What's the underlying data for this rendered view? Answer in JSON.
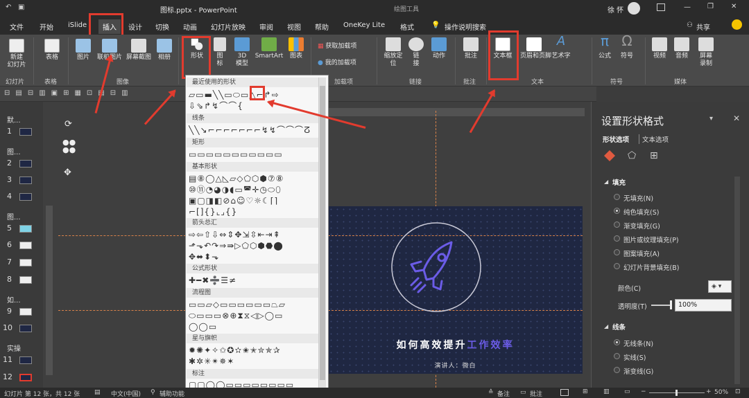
{
  "window": {
    "title": "图标.pptx - PowerPoint",
    "context_tool": "绘图工具",
    "user": "徐 怀",
    "minimize": "—",
    "maximize": "❐",
    "close": "✕",
    "restore": "⊟"
  },
  "tabs": [
    "文件",
    "开始",
    "iSlide",
    "插入",
    "设计",
    "切换",
    "动画",
    "幻灯片放映",
    "审阅",
    "视图",
    "帮助",
    "OneKey Lite",
    "格式"
  ],
  "tell_me": "操作说明搜索",
  "share": "共享",
  "ribbon": {
    "new_slide": "新建\n幻灯片",
    "table": "表格",
    "picture": "图片",
    "online_picture": "联机图片",
    "screenshot": "屏幕截图",
    "album": "相册",
    "shapes": "形状",
    "icons": "图\n标",
    "model3d": "3D\n模型",
    "smartart": "SmartArt",
    "chart": "图表",
    "get_addins": "获取加载项",
    "my_addins": "我的加载项",
    "zoom": "缩放定\n位",
    "link": "链\n接",
    "action": "动作",
    "comment": "批注",
    "textbox": "文本框",
    "header_footer": "页眉和页脚",
    "wordart": "艺术字",
    "equation": "公式",
    "symbol": "符号",
    "video": "视频",
    "audio": "音频",
    "screen_record": "屏幕\n录制",
    "groups": [
      "幻灯片",
      "表格",
      "图像",
      "加载项",
      "链接",
      "批注",
      "文本",
      "符号",
      "媒体"
    ]
  },
  "slide_panel": {
    "sections": [
      "默...",
      "图...",
      "图...",
      "如...",
      "实操"
    ],
    "numbers": [
      "1",
      "2",
      "3",
      "4",
      "5",
      "6",
      "7",
      "8",
      "9",
      "10",
      "11",
      "12"
    ]
  },
  "dropdown": {
    "headers": [
      "最近使用的形状",
      "线条",
      "矩形",
      "基本形状",
      "箭头总汇",
      "公式形状",
      "流程图",
      "星与旗帜",
      "标注"
    ],
    "rows": {
      "recent": [
        "▱▭▬╲╲▭⬭▭△⌐↱⇨",
        "⇩⇘↱↯⌒⌒{"
      ],
      "lines": [
        "╲╲↘⌐⌐⌐⌐⌐⌐⌐↯↯⌒⌒⌒ⵒ"
      ],
      "rect": [
        "▭▭▭▭▭▭▭▭▭▭▭"
      ],
      "basic": [
        "▤⑧◯△◺▱◇⬠⬡⬢⑦⑧",
        "⑩⑪◔◕◑◖▭◚✛◷⬭⬯",
        "▣▢◨◧⊘⌂☺♡☼☾⌈⌉",
        "⌐[]{}⌞⌟{}"
      ],
      "arrows": [
        "⇨⇦⇧⇩⇔⇕✥⇲⇳⇤⇥⇞",
        "⬏⬎↶↷⇒⇛▷⬠⬡⬢⬣⬤",
        "✥⬌⬍⬎"
      ],
      "equation": [
        "✚━✖➗☰≠"
      ],
      "flow": [
        "▭▭▱◇▭▭▭▭▭▭⏢▱",
        "⬭▭▭▭⊗⊕⧗⧖◁▷◯▭",
        "◯◯▭"
      ],
      "stars": [
        "✹✺✦✧✩✪✫✬✭✮✯✰",
        "✱✲✳✴✵✶"
      ],
      "callout": [
        "▢▢◯◯▭▭▭▭▭▭▭▭"
      ]
    }
  },
  "slide": {
    "title_a": "如何高效提升",
    "title_b": "工作效率",
    "subtitle": "演讲人：微白"
  },
  "format_pane": {
    "title": "设置形状格式",
    "tab_shape": "形状选项",
    "tab_text": "文本选项",
    "fill_section": "填充",
    "fill_options": [
      "无填充(N)",
      "纯色填充(S)",
      "渐变填充(G)",
      "图片或纹理填充(P)",
      "图案填充(A)",
      "幻灯片背景填充(B)"
    ],
    "color_label": "颜色(C)",
    "transparency_label": "透明度(T)",
    "transparency_value": "100%",
    "line_section": "线条",
    "line_options": [
      "无线条(N)",
      "实线(S)",
      "渐变线(G)"
    ]
  },
  "statusbar": {
    "slide_info": "幻灯片 第 12 张，共 12 张",
    "language": "中文(中国)",
    "accessibility": "辅助功能",
    "notes": "备注",
    "comments": "批注",
    "zoom": "50%"
  },
  "colors": {
    "accent_red": "#e23b2e",
    "slide_bg": "#1f2742",
    "rocket": "#6b5ce7"
  }
}
